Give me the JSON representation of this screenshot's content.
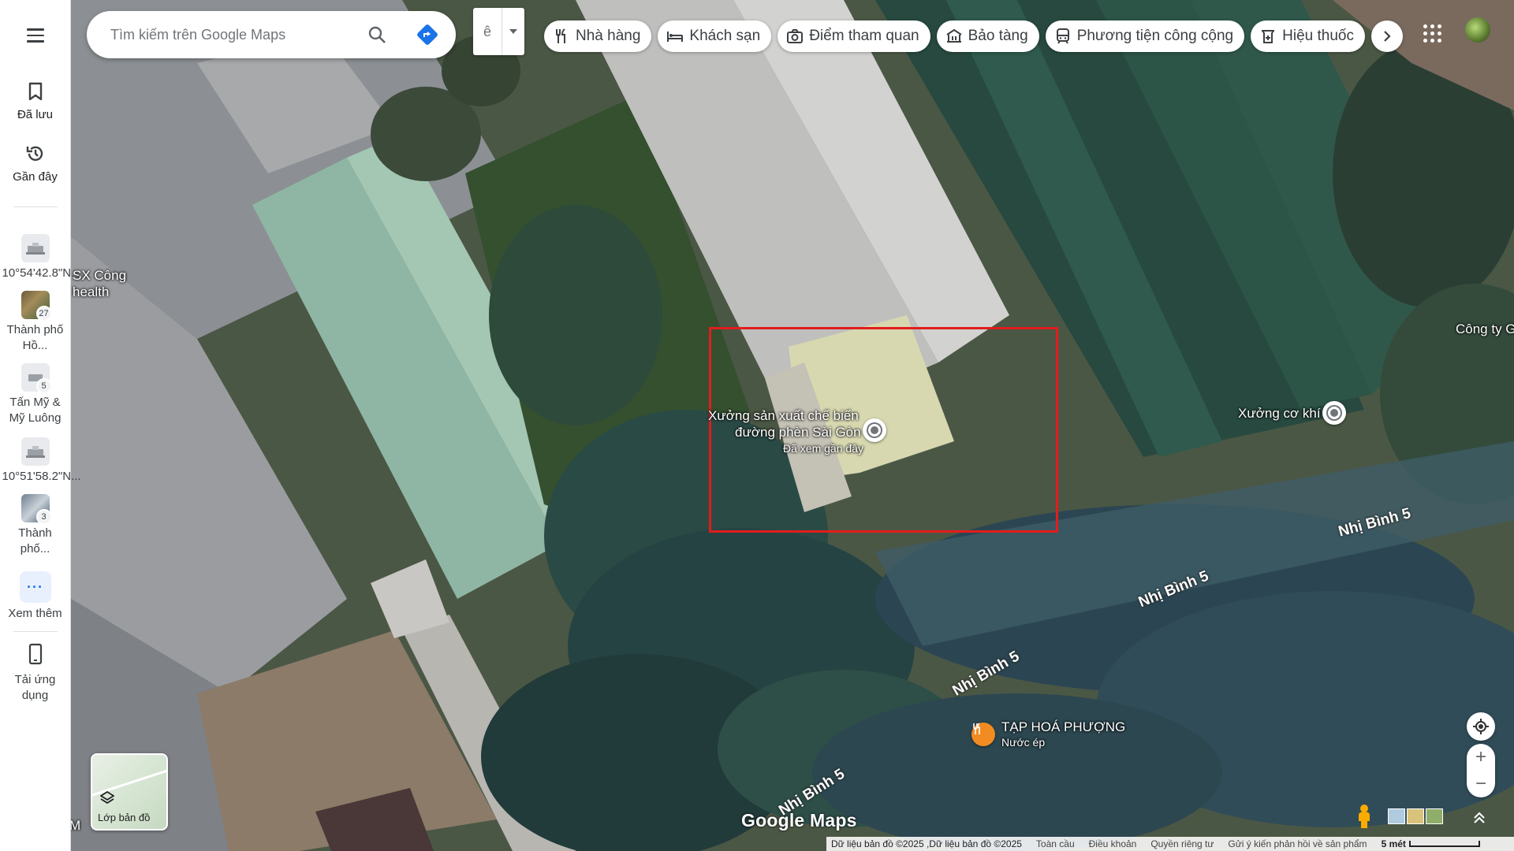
{
  "sidebar": {
    "menu_icon": "hamburger-menu-icon",
    "saved_label": "Đã lưu",
    "recent_label": "Gần đây",
    "recent_items": [
      {
        "label": "10°54'42.8\"N...",
        "badge": ""
      },
      {
        "label": "Thành phố Hồ...",
        "badge": "27"
      },
      {
        "label": "Tấn Mỹ & Mỹ Luông",
        "badge": "5"
      },
      {
        "label": "10°51'58.2\"N...",
        "badge": ""
      },
      {
        "label": "Thành phố...",
        "badge": "3"
      }
    ],
    "more_label": "Xem thêm",
    "app_label": "Tải ứng dụng"
  },
  "search": {
    "placeholder": "Tìm kiếm trên Google Maps",
    "search_icon": "search-icon",
    "directions_icon": "directions-icon"
  },
  "lang": {
    "label": "ê"
  },
  "chips": [
    {
      "label": "Nhà hàng",
      "icon": "restaurant-icon"
    },
    {
      "label": "Khách sạn",
      "icon": "hotel-icon"
    },
    {
      "label": "Điểm tham quan",
      "icon": "camera-icon"
    },
    {
      "label": "Bảo tàng",
      "icon": "museum-icon"
    },
    {
      "label": "Phương tiện công cộng",
      "icon": "transit-icon"
    },
    {
      "label": "Hiệu thuốc",
      "icon": "pharmacy-icon"
    }
  ],
  "map": {
    "labels": {
      "left_business": "SX Công",
      "left_business2": "health",
      "cong_ty": "Công ty G",
      "left_edge": "M"
    },
    "selected_place": {
      "name_line1": "Xưởng sản xuất chế biến",
      "name_line2": "đường phèn Sài Gòn",
      "note": "Đã xem gần đây"
    },
    "place_xuong": "Xưởng cơ khí",
    "place_tap_hoa": {
      "name": "TẠP HOÁ PHƯỢNG",
      "sub": "Nước ép"
    },
    "road_name": "Nhị Bình 5",
    "highlight_color": "#e11d1d"
  },
  "layer": {
    "label": "Lớp bản đồ"
  },
  "logo": "Google Maps",
  "footer": {
    "attribution": "Dữ liệu bản đồ ©2025 ,Dữ liệu bản đồ ©2025",
    "global": "Toàn cầu",
    "terms": "Điều khoản",
    "privacy": "Quyền riêng tư",
    "feedback": "Gửi ý kiến phản hồi về sản phẩm",
    "scale": "5 mét"
  }
}
